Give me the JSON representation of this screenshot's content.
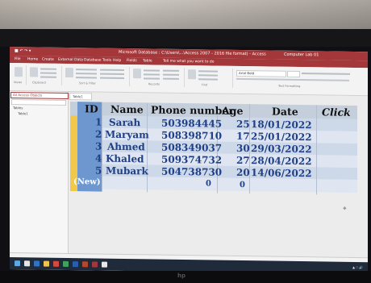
{
  "window": {
    "title": "Microsoft Database : C:\\Users\\...\\Access 2007 - 2016 file format) - Access",
    "user": "Computer Lab 01"
  },
  "menu": [
    "File",
    "Home",
    "Create",
    "External Data",
    "Database Tools",
    "Help",
    "Fields",
    "Table",
    "Tell me what you want to do"
  ],
  "ribbon": {
    "groups": [
      "Views",
      "Clipboard",
      "Sort & Filter",
      "Records",
      "Find",
      "Text Formatting"
    ],
    "font_name": "Arial Bold"
  },
  "nav_pane": {
    "header": "All Access Objects",
    "items": [
      "Tables",
      "Table1"
    ]
  },
  "doc_tab": "Table1",
  "table": {
    "columns": [
      "ID",
      "Name",
      "Phone number",
      "Age",
      "Date",
      "Click"
    ],
    "rows": [
      {
        "id": "1",
        "name": "Sarah",
        "phone": "503984445",
        "age": "25",
        "date": "18/01/2022"
      },
      {
        "id": "2",
        "name": "Maryam",
        "phone": "508398710",
        "age": "17",
        "date": "25/01/2022"
      },
      {
        "id": "3",
        "name": "Ahmed",
        "phone": "508349037",
        "age": "30",
        "date": "29/03/2022"
      },
      {
        "id": "4",
        "name": "Khaled",
        "phone": "509374732",
        "age": "27",
        "date": "28/04/2022"
      },
      {
        "id": "5",
        "name": "Mubark",
        "phone": "504738730",
        "age": "20",
        "date": "14/06/2022"
      }
    ],
    "new_row": {
      "id": "(New)",
      "phone": "0",
      "age": "0"
    }
  },
  "monitor_brand": "hp"
}
